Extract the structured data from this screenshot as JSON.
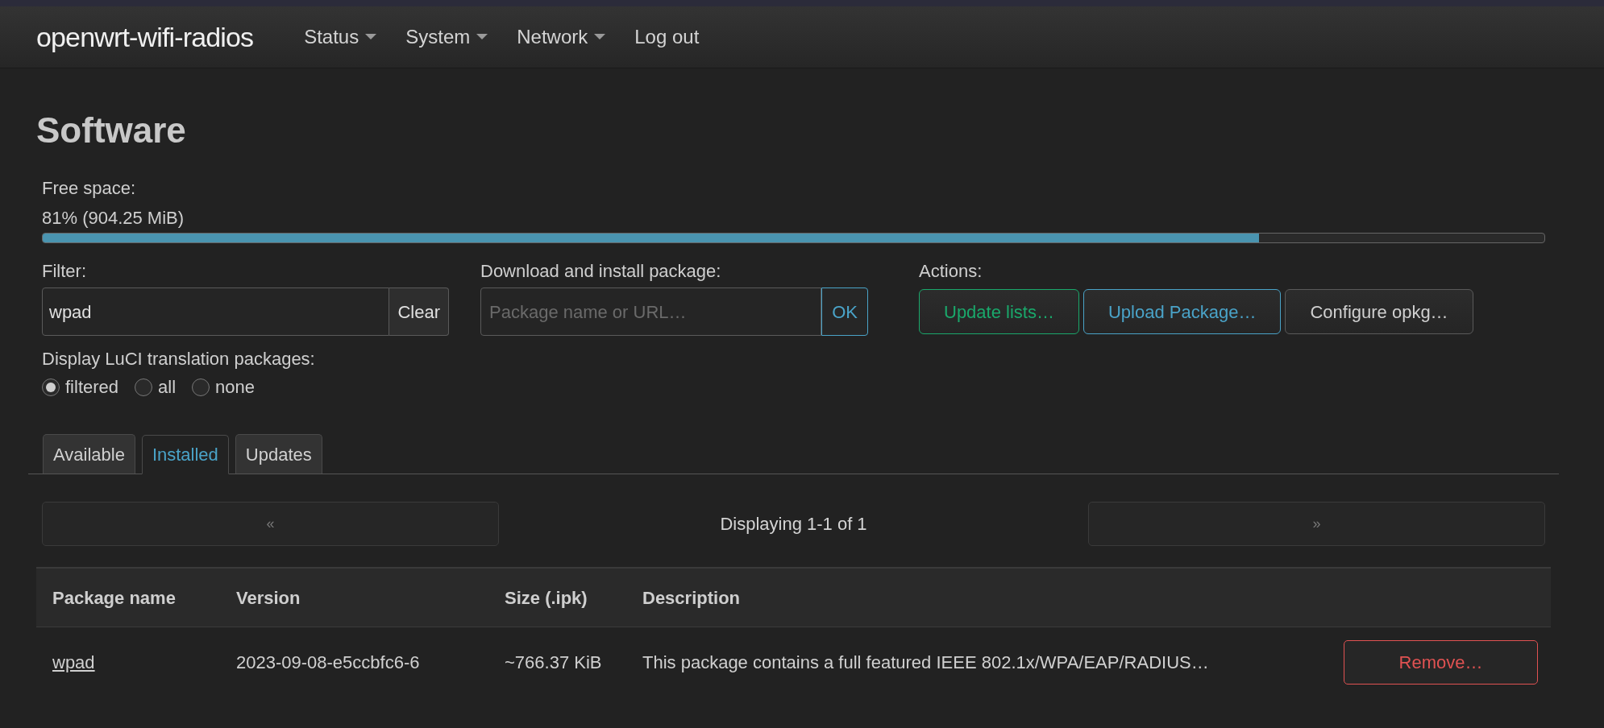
{
  "header": {
    "brand": "openwrt-wifi-radios",
    "menu": [
      {
        "label": "Status",
        "dropdown": true
      },
      {
        "label": "System",
        "dropdown": true
      },
      {
        "label": "Network",
        "dropdown": true
      },
      {
        "label": "Log out",
        "dropdown": false
      }
    ]
  },
  "title": "Software",
  "free_space": {
    "label": "Free space:",
    "reading": "81% (904.25 MiB)",
    "level": 0.81
  },
  "filter": {
    "label": "Filter:",
    "value": "wpad",
    "button": "Clear"
  },
  "download": {
    "label": "Download and install package:",
    "placeholder": "Package name or URL…",
    "button": "OK"
  },
  "actions": {
    "label": "Actions:",
    "buttons": [
      {
        "label": "Update lists…",
        "kind": "positive"
      },
      {
        "label": "Upload Package…",
        "kind": "action"
      },
      {
        "label": "Configure opkg…",
        "kind": "neutral"
      }
    ]
  },
  "translations": {
    "label": "Display LuCI translation packages:",
    "options": [
      {
        "label": "filtered",
        "selected": true
      },
      {
        "label": "all",
        "selected": false
      },
      {
        "label": "none",
        "selected": false
      }
    ]
  },
  "tabs": [
    {
      "label": "Available",
      "selected": false
    },
    {
      "label": "Installed",
      "selected": true
    },
    {
      "label": "Updates",
      "selected": false
    }
  ],
  "pager": {
    "prev": "«",
    "status": "Displaying 1-1 of 1",
    "next": "»"
  },
  "table": {
    "columns": [
      "Package name",
      "Version",
      "Size (.ipk)",
      "Description"
    ],
    "rows": [
      {
        "name": "wpad",
        "version": "2023-09-08-e5ccbfc6-6",
        "size": "~766.37 KiB",
        "description": "This package contains a full featured IEEE 802.1x/WPA/EAP/RADIUS…",
        "action": "Remove…"
      }
    ]
  }
}
